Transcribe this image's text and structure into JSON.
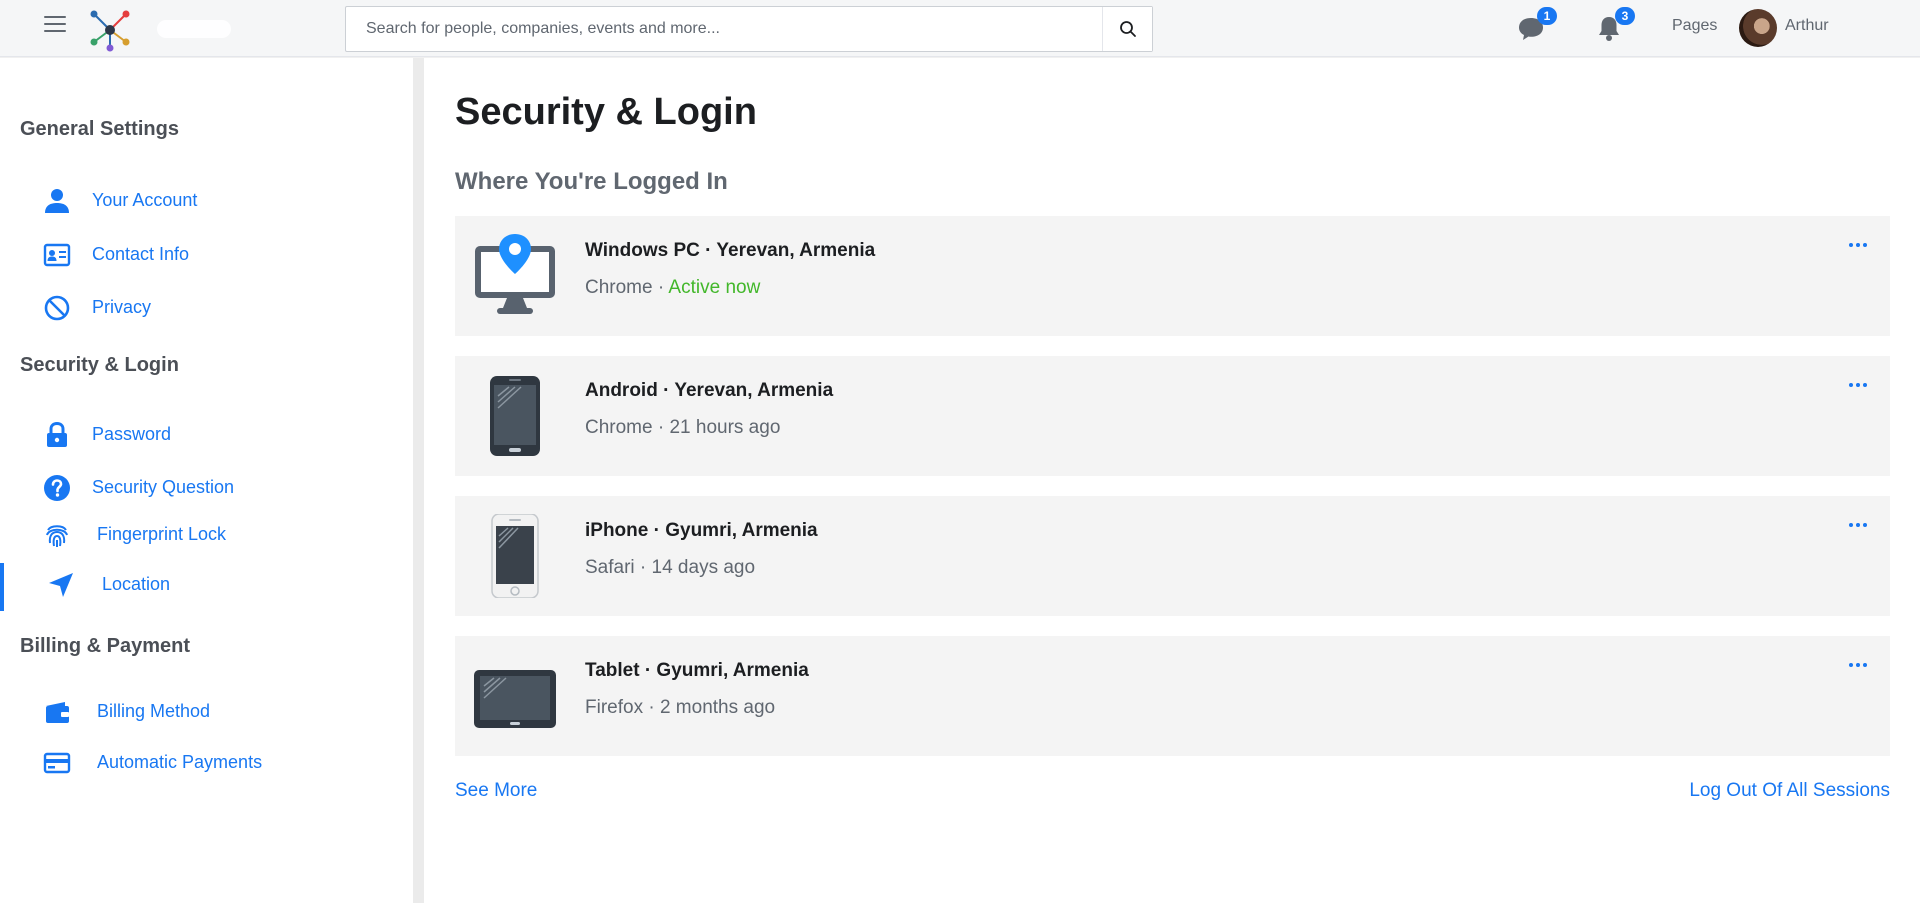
{
  "header": {
    "search_placeholder": "Search for people, companies, events and more...",
    "messages_badge": "1",
    "notifications_badge": "3",
    "pages_label": "Pages",
    "username": "Arthur"
  },
  "sidebar": {
    "sections": [
      {
        "title": "General Settings"
      },
      {
        "title": "Security & Login"
      },
      {
        "title": "Billing & Payment"
      }
    ],
    "items": [
      {
        "label": "Your Account",
        "icon": "user-icon"
      },
      {
        "label": "Contact Info",
        "icon": "contact-card-icon"
      },
      {
        "label": "Privacy",
        "icon": "block-icon"
      },
      {
        "label": "Password",
        "icon": "lock-icon"
      },
      {
        "label": "Security Question",
        "icon": "question-icon"
      },
      {
        "label": "Fingerprint Lock",
        "icon": "fingerprint-icon"
      },
      {
        "label": "Location",
        "icon": "location-arrow-icon",
        "active": true
      },
      {
        "label": "Billing Method",
        "icon": "wallet-icon"
      },
      {
        "label": "Automatic Payments",
        "icon": "credit-card-icon"
      }
    ]
  },
  "main": {
    "title": "Security & Login",
    "subtitle": "Where You're Logged In",
    "sessions": [
      {
        "device": "Windows PC · Yerevan, Armenia",
        "browser": "Chrome · ",
        "status": "Active now",
        "icon": "desktop-location-icon"
      },
      {
        "device": "Android · Yerevan, Armenia",
        "browser": "Chrome · 21 hours ago",
        "icon": "android-phone-icon"
      },
      {
        "device": "iPhone · Gyumri, Armenia",
        "browser": "Safari · 14 days ago",
        "icon": "iphone-icon"
      },
      {
        "device": "Tablet · Gyumri, Armenia",
        "browser": "Firefox · 2 months ago",
        "icon": "tablet-icon"
      }
    ],
    "see_more": "See More",
    "logout_all": "Log Out Of All Sessions"
  },
  "colors": {
    "accent": "#1877f2",
    "active_status": "#42b72a"
  }
}
